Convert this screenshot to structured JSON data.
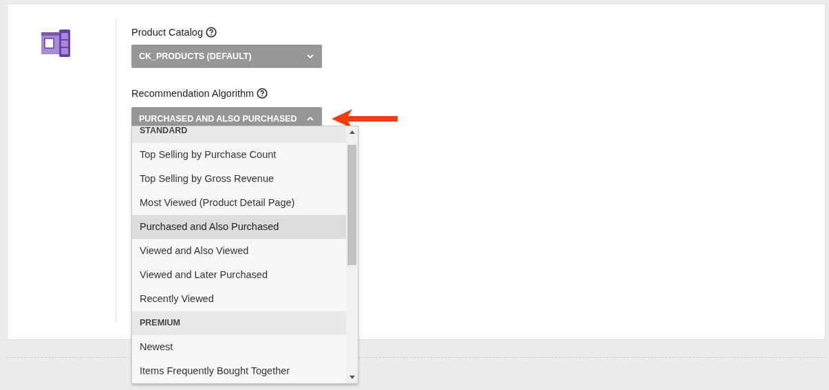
{
  "catalog": {
    "label": "Product Catalog",
    "value": "CK_PRODUCTS (DEFAULT)"
  },
  "algorithm": {
    "label": "Recommendation Algorithm",
    "value": "PURCHASED AND ALSO PURCHASED",
    "expanded": true
  },
  "options": [
    {
      "kind": "header",
      "label": "STANDARD"
    },
    {
      "kind": "option",
      "label": "Top Selling by Purchase Count",
      "selected": false
    },
    {
      "kind": "option",
      "label": "Top Selling by Gross Revenue",
      "selected": false
    },
    {
      "kind": "option",
      "label": "Most Viewed (Product Detail Page)",
      "selected": false
    },
    {
      "kind": "option",
      "label": "Purchased and Also Purchased",
      "selected": true
    },
    {
      "kind": "option",
      "label": "Viewed and Also Viewed",
      "selected": false
    },
    {
      "kind": "option",
      "label": "Viewed and Later Purchased",
      "selected": false
    },
    {
      "kind": "option",
      "label": "Recently Viewed",
      "selected": false
    },
    {
      "kind": "header",
      "label": "PREMIUM"
    },
    {
      "kind": "option",
      "label": "Newest",
      "selected": false
    },
    {
      "kind": "option",
      "label": "Items Frequently Bought Together",
      "selected": false
    }
  ]
}
